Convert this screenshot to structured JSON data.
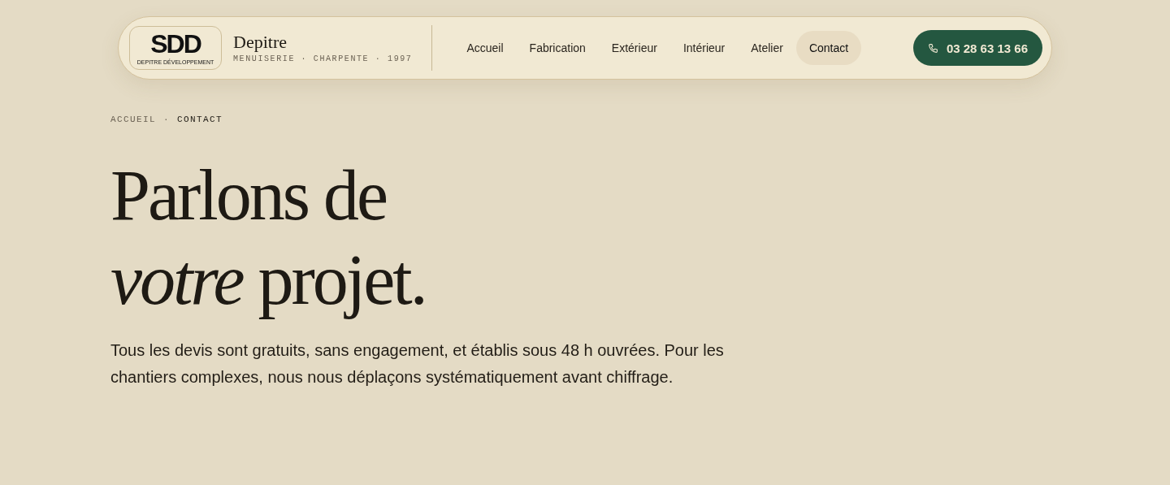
{
  "logo": {
    "mark": "SDD",
    "caption": "DEPITRE DÉVELOPPEMENT"
  },
  "brand": {
    "name": "Depitre",
    "tagline": "MENUISERIE · CHARPENTE · 1997"
  },
  "nav": [
    {
      "label": "Accueil",
      "selected": false
    },
    {
      "label": "Fabrication",
      "selected": false
    },
    {
      "label": "Extérieur",
      "selected": false
    },
    {
      "label": "Intérieur",
      "selected": false
    },
    {
      "label": "Atelier",
      "selected": false
    },
    {
      "label": "Contact",
      "selected": true
    }
  ],
  "phone_button": {
    "label": "03 28 63 13 66"
  },
  "breadcrumb": [
    {
      "label": "ACCUEIL",
      "selected": false
    },
    {
      "label": "·",
      "selected": false
    },
    {
      "label": "CONTACT",
      "selected": true
    }
  ],
  "heading": [
    "Parlons de",
    "*votre* projet."
  ],
  "intro": "Tous les devis sont gratuits, sans engagement, et établis sous 48 h ouvrées. Pour les chantiers complexes, nous nous déplaçons systématiquement avant chiffrage."
}
